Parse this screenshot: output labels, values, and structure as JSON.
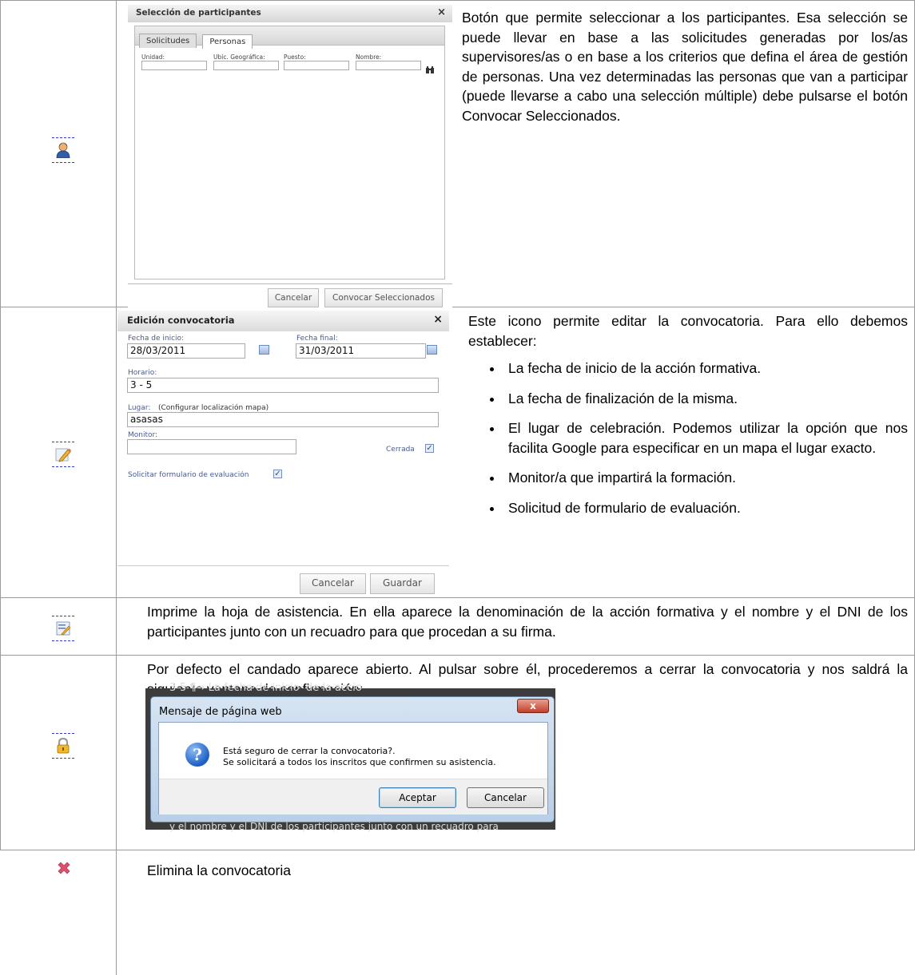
{
  "rows": [
    {
      "icon": "participants-icon",
      "description": "Botón que permite seleccionar a los participantes. Esa selección se puede llevar en base a las solicitudes generadas por los/as supervisores/as o en base a los criterios que defina el área de gestión de personas. Una vez determinadas las personas que van a participar (puede llevarse a cabo una selección múltiple) debe pulsarse el botón Convocar Seleccionados."
    },
    {
      "icon": "edit-pencil-icon",
      "intro": "Este icono permite editar la convocatoria. Para ello debemos establecer:",
      "bullets": [
        "La fecha de inicio de la acción formativa.",
        "La fecha de finalización de la misma.",
        "El lugar de celebración. Podemos utilizar la opción que nos facilita Google para especificar en un mapa el lugar exacto.",
        "Monitor/a que impartirá la formación.",
        "Solicitud de formulario de evaluación."
      ]
    },
    {
      "icon": "print-attendance-icon",
      "description": "Imprime la hoja de asistencia. En ella aparece la denominación de la acción formativa y el nombre y el DNI de los participantes junto con un recuadro para que procedan a su firma."
    },
    {
      "icon": "padlock-icon",
      "description": "Por defecto el candado aparece abierto. Al pulsar sobre él, procederemos a cerrar la convocatoria y nos saldrá la siguiente ventana de confirmación:"
    },
    {
      "icon": "delete-x-icon",
      "description": "Elimina la convocatoria"
    }
  ],
  "participants_dialog": {
    "title": "Selección de participantes",
    "close": "×",
    "tabs": [
      "Solicitudes",
      "Personas"
    ],
    "fields": [
      "Unidad:",
      "Ubic. Geográfica:",
      "Puesto:",
      "Nombre:"
    ],
    "cancel": "Cancelar",
    "convocar": "Convocar Seleccionados"
  },
  "edit_dialog": {
    "title": "Edición convocatoria",
    "close": "×",
    "start_label": "Fecha de inicio:",
    "start_value": "28/03/2011",
    "end_label": "Fecha final:",
    "end_value": "31/03/2011",
    "schedule_label": "Horario:",
    "schedule_value": "3 - 5",
    "place_label": "Lugar:",
    "map_link": "(Configurar localización mapa)",
    "place_value": "asasas",
    "monitor_label": "Monitor:",
    "monitor_value": "",
    "closed_label": "Cerrada",
    "eval_label": "Solicitar formulario de evaluación",
    "cancel": "Cancelar",
    "save": "Guardar"
  },
  "confirm_dialog": {
    "bg_top": "3-5                                    ¶→ La·fecha·de·inicio· de·la·accio",
    "bg_bottom": "y el nombre y el DNI de los participantes junto con un recuadro para",
    "title": "Mensaje de página web",
    "close": "x",
    "line1": "Está seguro de cerrar la convocatoria?.",
    "line2": " Se solicitará a todos los inscritos que confirmen su asistencia.",
    "accept": "Aceptar",
    "cancel": "Cancelar"
  }
}
